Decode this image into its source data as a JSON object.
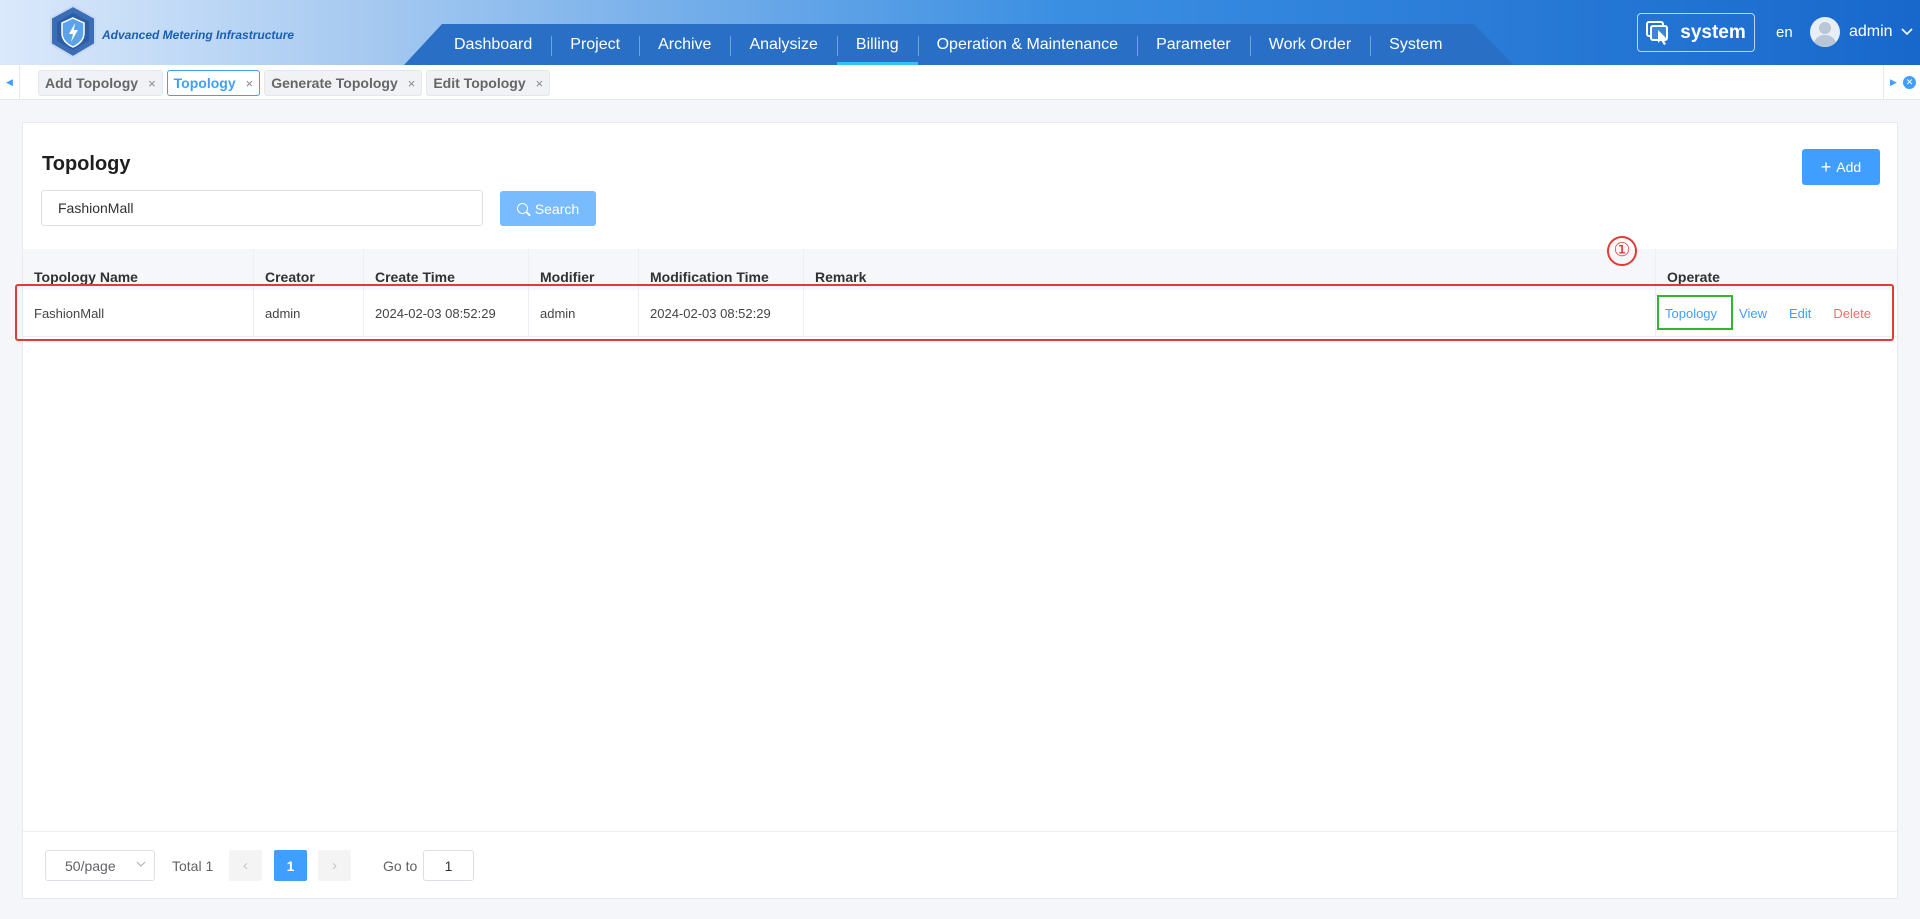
{
  "app": {
    "title": "Advanced Metering Infrastructure"
  },
  "nav": {
    "items": [
      {
        "label": "Dashboard",
        "active": false
      },
      {
        "label": "Project",
        "active": false
      },
      {
        "label": "Archive",
        "active": false
      },
      {
        "label": "Analysize",
        "active": false
      },
      {
        "label": "Billing",
        "active": true
      },
      {
        "label": "Operation & Maintenance",
        "active": false
      },
      {
        "label": "Parameter",
        "active": false
      },
      {
        "label": "Work Order",
        "active": false
      },
      {
        "label": "System",
        "active": false
      }
    ],
    "active_color": "#33c4f2"
  },
  "header": {
    "system_label": "system",
    "lang": "en",
    "user": "admin"
  },
  "tabs": [
    {
      "label": "Add Topology",
      "close": "×",
      "active": false
    },
    {
      "label": "Topology",
      "close": "×",
      "active": true
    },
    {
      "label": "Generate Topology",
      "close": "×",
      "active": false
    },
    {
      "label": "Edit Topology",
      "close": "×",
      "active": false
    }
  ],
  "page": {
    "title": "Topology",
    "add_label": "Add",
    "search": {
      "value": "FashionMall",
      "button": "Search"
    }
  },
  "table": {
    "columns": [
      "Topology Name",
      "Creator",
      "Create Time",
      "Modifier",
      "Modification Time",
      "Remark",
      "Operate"
    ],
    "rows": [
      {
        "name": "FashionMall",
        "creator": "admin",
        "create_time": "2024-02-03 08:52:29",
        "modifier": "admin",
        "modification_time": "2024-02-03 08:52:29",
        "remark": "",
        "ops": {
          "topology": "Topology",
          "view": "View",
          "edit": "Edit",
          "delete": "Delete"
        }
      }
    ]
  },
  "annotation": {
    "marker": "①",
    "row_color": "#e53935",
    "op_color": "#2eb82e"
  },
  "pagination": {
    "page_size": "50/page",
    "total": "Total 1",
    "prev": "‹",
    "next": "›",
    "current": "1",
    "goto_label": "Go to",
    "goto_value": "1"
  },
  "colors": {
    "primary": "#409eff",
    "danger": "#f56c6c"
  }
}
